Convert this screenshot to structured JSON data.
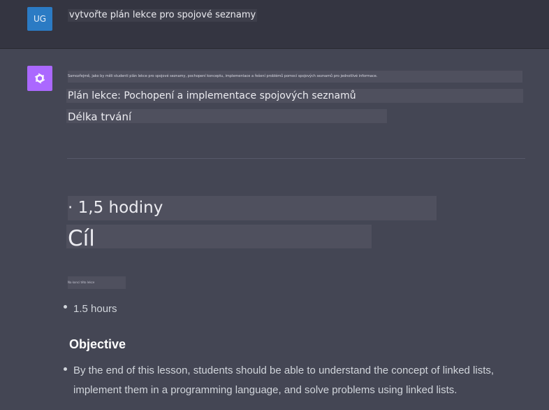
{
  "user_message": {
    "avatar_initials": "UG",
    "text": "vytvořte plán lekce pro spojové seznamy"
  },
  "assistant_message": {
    "avatar_icon": "openai-logo-icon",
    "intro_text": "Samozřejmě, jako by měli studenti plán lekce pro spojové seznamy, pochopení konceptu, implementace a řešení problémů pomocí spojových seznamů pro jednotlivé informace.",
    "lesson_title": "Plán lekce: Pochopení a implementace spojových seznamů",
    "duration_heading": "Délka trvání",
    "duration_value": "· 1,5 hodiny",
    "objective_heading_cs": "Cíl",
    "tiny_text": "Na konci této lekce",
    "list_duration": "1.5 hours",
    "objective_heading": "Objective",
    "objective_line1": "By the end of this lesson, students should be able to understand the concept of linked lists,",
    "objective_line2": "implement them in a programming language, and solve problems using linked lists."
  },
  "colors": {
    "page_bg": "#444654",
    "user_row_bg": "#343541",
    "user_avatar": "#2b7bc4",
    "bot_avatar": "#ab68ff",
    "highlight": "#4f505e"
  }
}
